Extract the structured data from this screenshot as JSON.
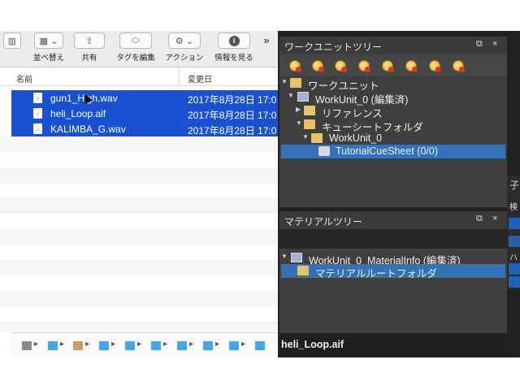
{
  "finder": {
    "toolbar": {
      "sort_label": "並べ替え",
      "share_label": "共有",
      "tag_label": "タグを編集",
      "action_label": "アクション",
      "info_label": "情報を見る",
      "more_glyph": "»"
    },
    "columns": {
      "name": "名前",
      "modified": "変更日"
    },
    "files": [
      {
        "name": "gun1_High.wav",
        "date": "2017年8月28日 17:0"
      },
      {
        "name": "heli_Loop.aif",
        "date": "2017年8月28日 17:0"
      },
      {
        "name": "KALIMBA_G.wav",
        "date": "2017年8月28日 17:0"
      }
    ]
  },
  "workunit_tree": {
    "title": "ワークユニットツリー",
    "items": {
      "root": "ワークユニット",
      "workunit": "WorkUnit_0 (編集済)",
      "reference": "リファレンス",
      "cuesheet_folder": "キューシートフォルダ",
      "workunit_child": "WorkUnit_0",
      "cuesheet": "TutorialCueSheet (0/0)"
    }
  },
  "material_tree": {
    "title": "マテリアルツリー",
    "items": {
      "materialinfo": "WorkUnit_0_MaterialInfo (編集済)",
      "root_folder": "マテリアルルートフォルダ"
    }
  },
  "info_panel": {
    "filename": "heli_Loop.aif"
  },
  "side_panel": {
    "title_char": "子",
    "label_char": "検",
    "row_chars": [
      "ハ"
    ]
  },
  "panel_controls": {
    "float": "⧉",
    "close": "×"
  }
}
